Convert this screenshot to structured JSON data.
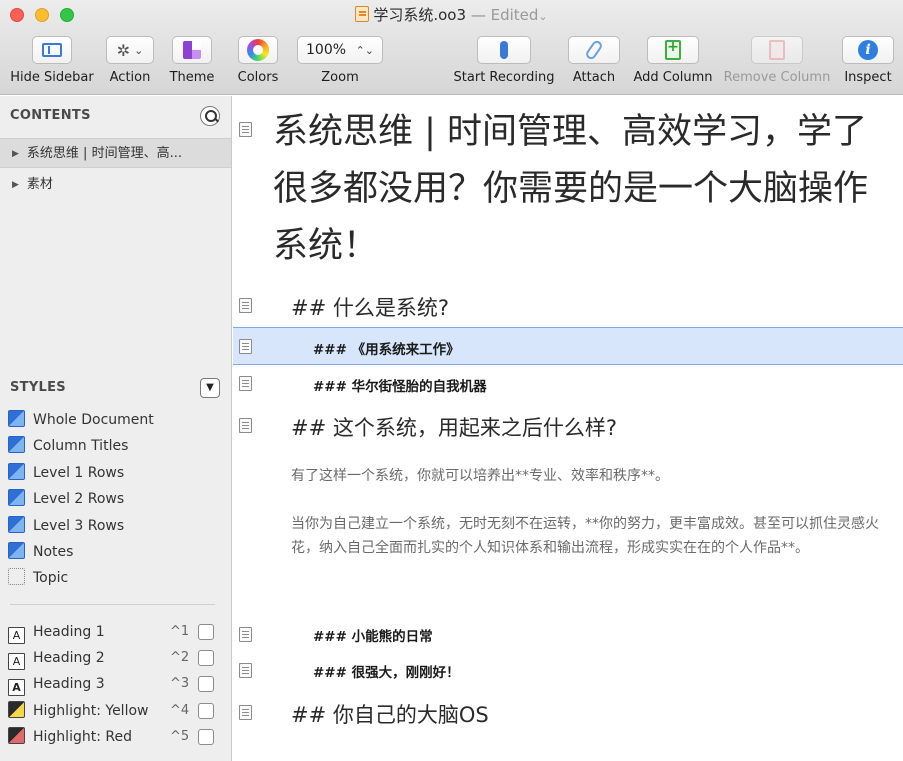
{
  "window": {
    "title": "学习系统.oo3",
    "separator": "—",
    "status": "Edited",
    "status_chevron": "⌄"
  },
  "toolbar": {
    "hide_sidebar": "Hide Sidebar",
    "action": "Action",
    "theme": "Theme",
    "colors": "Colors",
    "zoom": "Zoom",
    "zoom_value": "100%",
    "zoom_stepper": "⌃⌄",
    "start_recording": "Start Recording",
    "attach": "Attach",
    "add_column": "Add Column",
    "remove_column": "Remove Column",
    "inspect": "Inspect",
    "action_chevron": "⌄",
    "gear_glyph": "✲",
    "inspect_glyph": "i"
  },
  "sidebar": {
    "contents_title": "CONTENTS",
    "outline": [
      {
        "label": "系统思维 | 时间管理、高...",
        "selected": true
      },
      {
        "label": "素材",
        "selected": false
      }
    ],
    "styles_title": "STYLES",
    "styles_dropdown_glyph": "▼",
    "styles": [
      {
        "label": "Whole Document"
      },
      {
        "label": "Column Titles"
      },
      {
        "label": "Level 1 Rows"
      },
      {
        "label": "Level 2 Rows"
      },
      {
        "label": "Level 3 Rows"
      },
      {
        "label": "Notes"
      },
      {
        "label": "Topic"
      }
    ],
    "named_styles": [
      {
        "label": "Heading 1",
        "shortcut": "^1",
        "swatch": "A"
      },
      {
        "label": "Heading 2",
        "shortcut": "^2",
        "swatch": "A"
      },
      {
        "label": "Heading 3",
        "shortcut": "^3",
        "swatch": "A"
      },
      {
        "label": "Highlight: Yellow",
        "shortcut": "^4"
      },
      {
        "label": "Highlight: Red",
        "shortcut": "^5"
      }
    ]
  },
  "outline": {
    "title": "系统思维 | 时间管理、高效学习，学了很多都没用？你需要的是一个大脑操作系统！",
    "h2_what": "## 什么是系统?",
    "h3_work": "### 《用系统来工作》",
    "h3_wall": "### 华尔街怪胎的自我机器",
    "h2_how": "## 这个系统，用起来之后什么样?",
    "para1": "有了这样一个系统，你就可以培养出**专业、效率和秩序**。",
    "para2": "当你为自己建立一个系统，无时无刻不在运转，**你的努力，更丰富成效。甚至可以抓住灵感火花，纳入自己全面而扎实的个人知识体系和输出流程，形成实实在在的个人作品**。",
    "h3_bear": "### 小能熊的日常",
    "h3_strong": "### 很强大，刚刚好！",
    "h2_os": "## 你自己的大脑OS"
  }
}
